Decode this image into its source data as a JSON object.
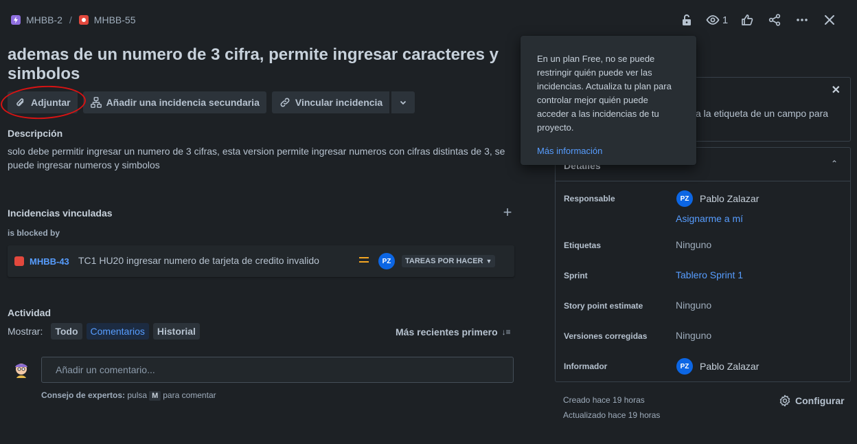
{
  "breadcrumb": {
    "parent_key": "MHBB-2",
    "separator": "/",
    "issue_key": "MHBB-55"
  },
  "toolbar": {
    "watch_count": "1"
  },
  "issue": {
    "title": "ademas de un numero de 3 cifra, permite ingresar caracteres y simbolos"
  },
  "actions": {
    "attach": "Adjuntar",
    "add_child": "Añadir una incidencia secundaria",
    "link_issue": "Vincular incidencia"
  },
  "description": {
    "heading": "Descripción",
    "text": "solo debe permitir ingresar un numero de 3 cifras, esta version permite ingresar numeros con cifras distintas de 3, se puede ingresar numeros y simbolos"
  },
  "linked": {
    "heading": "Incidencias vinculadas",
    "relation": "is blocked by",
    "items": [
      {
        "key": "MHBB-43",
        "summary": "TC1 HU20 ingresar numero de tarjeta de credito invalido",
        "assignee_initials": "PZ",
        "status": "TAREAS POR HACER"
      }
    ]
  },
  "activity": {
    "heading": "Actividad",
    "show_label": "Mostrar:",
    "filters": [
      "Todo",
      "Comentarios",
      "Historial"
    ],
    "sort_label": "Más recientes primero",
    "comment_placeholder": "Añadir un comentario...",
    "tip_prefix": "Consejo de expertos:",
    "tip_mid": "pulsa",
    "tip_key": "M",
    "tip_suffix": "para comentar"
  },
  "popup": {
    "text": "En un plan Free, no se puede restringir quién puede ver las incidencias. Actualiza tu plan para controlar mejor quién puede acceder a las incidencias de tu proyecto.",
    "link": "Más información"
  },
  "panel_notice": {
    "visible_text": "a la etiqueta de un campo para"
  },
  "details": {
    "heading": "Detalles",
    "responsable_label": "Responsable",
    "responsable_name": "Pablo Zalazar",
    "responsable_initials": "PZ",
    "assign_me": "Asignarme a mí",
    "etiquetas_label": "Etiquetas",
    "etiquetas_value": "Ninguno",
    "sprint_label": "Sprint",
    "sprint_value": "Tablero Sprint 1",
    "story_label": "Story point estimate",
    "story_value": "Ninguno",
    "versions_label": "Versiones corregidas",
    "versions_value": "Ninguno",
    "reporter_label": "Informador",
    "reporter_name": "Pablo Zalazar",
    "reporter_initials": "PZ"
  },
  "footer": {
    "created": "Creado hace 19 horas",
    "updated": "Actualizado hace 19 horas",
    "configure": "Configurar"
  }
}
